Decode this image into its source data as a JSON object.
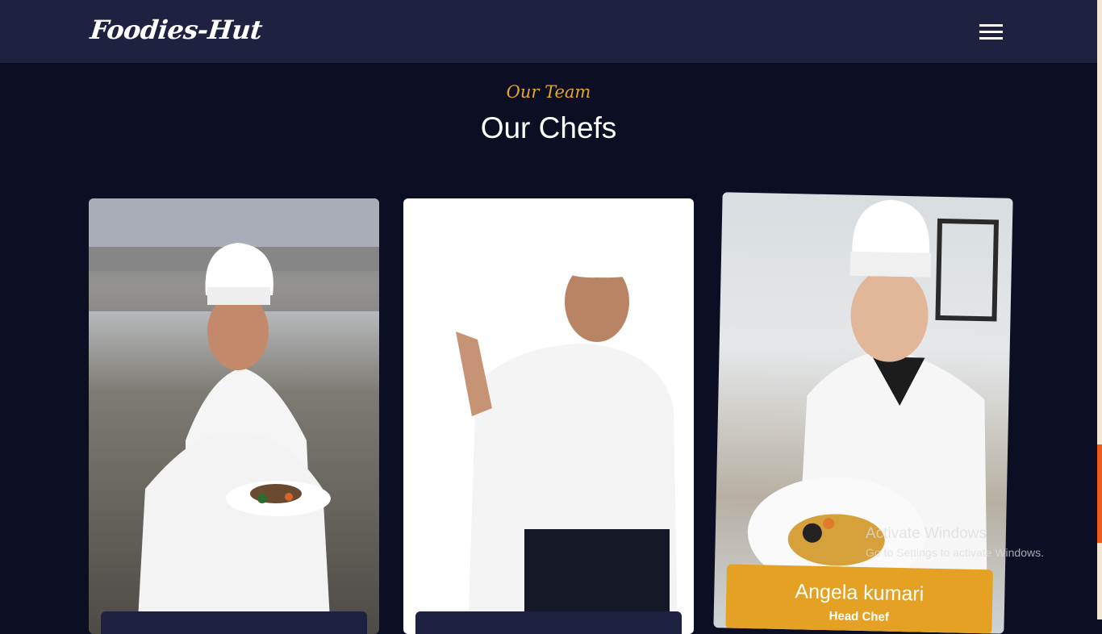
{
  "header": {
    "logo": "Foodies-Hut",
    "menu_icon": "hamburger-menu-icon"
  },
  "section": {
    "subtitle": "Our Team",
    "title": "Our Chefs"
  },
  "chefs": [
    {
      "name": "",
      "role": ""
    },
    {
      "name": "",
      "role": ""
    },
    {
      "name": "Angela kumari",
      "role": "Head Chef"
    }
  ],
  "overlay": {
    "activate_title": "Activate Windows",
    "activate_sub": "Go to Settings to activate Windows."
  },
  "colors": {
    "nav_bg": "#1e2140",
    "page_bg": "#0c0f24",
    "accent_gold": "#e4a124",
    "accent_orange": "#f05a1a"
  }
}
